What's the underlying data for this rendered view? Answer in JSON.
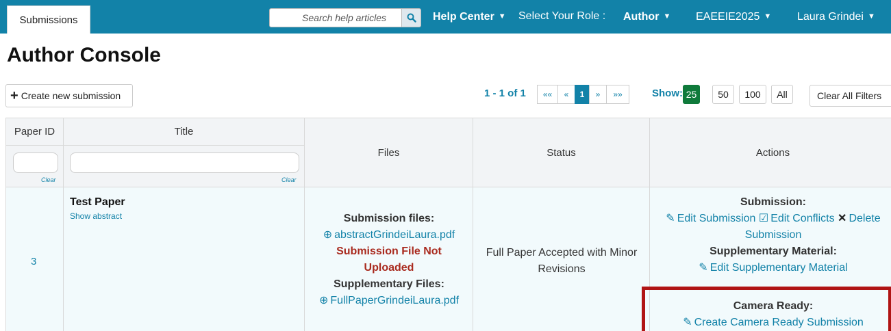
{
  "nav": {
    "tab_label": "Submissions",
    "search_placeholder": "Search help articles",
    "help_center": "Help Center",
    "role_label": "Select Your Role :",
    "role_value": "Author",
    "conference": "EAEEIE2025",
    "user": "Laura Grindei"
  },
  "page": {
    "title": "Author Console"
  },
  "toolbar": {
    "create_label": "Create new submission",
    "pager_summary": "1 - 1 of 1",
    "pager": {
      "first": "««",
      "prev": "«",
      "current": "1",
      "next": "»",
      "last": "»»"
    },
    "show_label": "Show:",
    "show_options": [
      "25",
      "50",
      "100",
      "All"
    ],
    "clear_filters": "Clear All Filters"
  },
  "table": {
    "headers": {
      "paper_id": "Paper ID",
      "title": "Title",
      "files": "Files",
      "status": "Status",
      "actions": "Actions"
    },
    "clear_label": "Clear",
    "row": {
      "paper_id": "3",
      "title": "Test Paper",
      "show_abstract": "Show abstract",
      "files": {
        "submission_heading": "Submission files:",
        "abstract_file": "abstractGrindeiLaura.pdf",
        "not_uploaded_1": "Submission File Not",
        "not_uploaded_2": "Uploaded",
        "supplementary_heading": "Supplementary Files:",
        "supplementary_file": "FullPaperGrindeiLaura.pdf"
      },
      "status_1": "Full Paper Accepted with Minor",
      "status_2": "Revisions",
      "actions": {
        "submission_heading": "Submission:",
        "edit_submission": "Edit Submission",
        "edit_conflicts": "Edit Conflicts",
        "delete_1": "Delete",
        "delete_2": "Submission",
        "supplementary_heading": "Supplementary Material:",
        "edit_supplementary": "Edit Supplementary Material",
        "camera_heading": "Camera Ready:",
        "create_camera_ready": "Create Camera Ready Submission"
      }
    }
  },
  "colors": {
    "nav_bg": "#1282a8",
    "accent": "#1282a8",
    "active_green": "#0f7a3b",
    "error_red": "#a92a1e",
    "highlight_red": "#b01414"
  }
}
